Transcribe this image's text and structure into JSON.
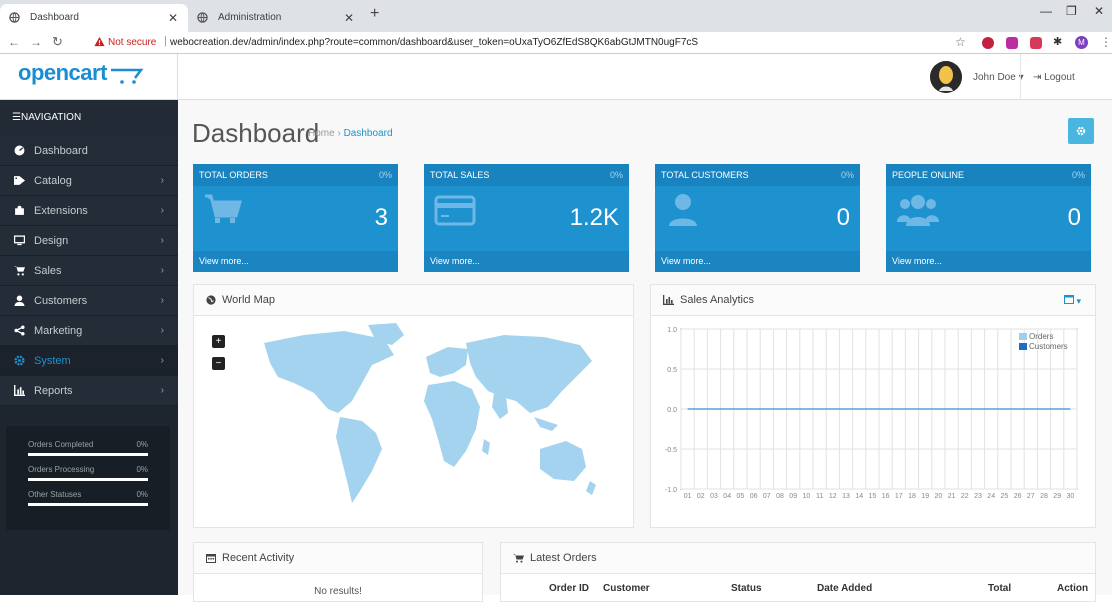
{
  "browser": {
    "tabs": [
      {
        "title": "Dashboard"
      },
      {
        "title": "Administration"
      }
    ],
    "not_secure": "Not secure",
    "url": "webocreation.dev/admin/index.php?route=common/dashboard&user_token=oUxaTyO6ZfEdS8QK6abGtJMTN0ugF7cS",
    "profile_initial": "M"
  },
  "header": {
    "logo": "opencart",
    "user_name": "John Doe",
    "logout": "Logout"
  },
  "sidebar": {
    "title": "NAVIGATION",
    "items": [
      {
        "label": "Dashboard",
        "icon": "dashboard-icon",
        "active": false
      },
      {
        "label": "Catalog",
        "icon": "tag-icon",
        "active": false
      },
      {
        "label": "Extensions",
        "icon": "puzzle-icon",
        "active": false
      },
      {
        "label": "Design",
        "icon": "monitor-icon",
        "active": false
      },
      {
        "label": "Sales",
        "icon": "cart-icon",
        "active": false
      },
      {
        "label": "Customers",
        "icon": "user-icon",
        "active": false
      },
      {
        "label": "Marketing",
        "icon": "share-icon",
        "active": false
      },
      {
        "label": "System",
        "icon": "cog-icon",
        "active": true
      },
      {
        "label": "Reports",
        "icon": "bar-chart-icon",
        "active": false
      }
    ],
    "stats": [
      {
        "label": "Orders Completed",
        "value": "0%"
      },
      {
        "label": "Orders Processing",
        "value": "0%"
      },
      {
        "label": "Other Statuses",
        "value": "0%"
      }
    ]
  },
  "page": {
    "title": "Dashboard",
    "breadcrumb": [
      "Home",
      "Dashboard"
    ]
  },
  "tiles": [
    {
      "title": "TOTAL ORDERS",
      "percent": "0%",
      "value": "3",
      "link": "View more..."
    },
    {
      "title": "TOTAL SALES",
      "percent": "0%",
      "value": "1.2K",
      "link": "View more..."
    },
    {
      "title": "TOTAL CUSTOMERS",
      "percent": "0%",
      "value": "0",
      "link": "View more..."
    },
    {
      "title": "PEOPLE ONLINE",
      "percent": "0%",
      "value": "0",
      "link": "View more..."
    }
  ],
  "world_map": {
    "title": "World Map",
    "zoom_in": "+",
    "zoom_out": "−"
  },
  "sales_analytics": {
    "title": "Sales Analytics"
  },
  "recent_activity": {
    "title": "Recent Activity",
    "empty": "No results!"
  },
  "latest_orders": {
    "title": "Latest Orders",
    "columns": [
      "Order ID",
      "Customer",
      "Status",
      "Date Added",
      "Total",
      "Action"
    ]
  },
  "colors": {
    "accent": "#1e91cf",
    "sidebar": "#1e252f",
    "orders_series": "#9ecfee",
    "customers_series": "#1a6fc4"
  },
  "chart_data": {
    "type": "line",
    "x": [
      "01",
      "02",
      "03",
      "04",
      "05",
      "06",
      "07",
      "08",
      "09",
      "10",
      "11",
      "12",
      "13",
      "14",
      "15",
      "16",
      "17",
      "18",
      "19",
      "20",
      "21",
      "22",
      "23",
      "24",
      "25",
      "26",
      "27",
      "28",
      "29",
      "30"
    ],
    "series": [
      {
        "name": "Orders",
        "values": [
          0,
          0,
          0,
          0,
          0,
          0,
          0,
          0,
          0,
          0,
          0,
          0,
          0,
          0,
          0,
          0,
          0,
          0,
          0,
          0,
          0,
          0,
          0,
          0,
          0,
          0,
          0,
          0,
          0,
          0
        ]
      },
      {
        "name": "Customers",
        "values": [
          0,
          0,
          0,
          0,
          0,
          0,
          0,
          0,
          0,
          0,
          0,
          0,
          0,
          0,
          0,
          0,
          0,
          0,
          0,
          0,
          0,
          0,
          0,
          0,
          0,
          0,
          0,
          0,
          0,
          0
        ]
      }
    ],
    "yticks": [
      "1.0",
      "0.5",
      "0.0",
      "-0.5",
      "-1.0"
    ],
    "ylim": [
      -1,
      1
    ],
    "grid": true,
    "legend": "top-right"
  }
}
